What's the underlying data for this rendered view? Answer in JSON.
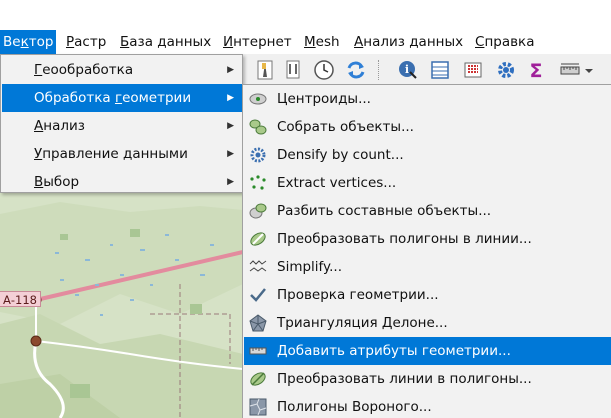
{
  "menubar": {
    "items": [
      {
        "pre": "Ве",
        "acc": "к",
        "post": "тор"
      },
      {
        "pre": "",
        "acc": "Р",
        "post": "астр"
      },
      {
        "pre": "",
        "acc": "Б",
        "post": "аза данных"
      },
      {
        "pre": "",
        "acc": "И",
        "post": "нтернет"
      },
      {
        "pre": "",
        "acc": "M",
        "post": "esh"
      },
      {
        "pre": "",
        "acc": "А",
        "post": "нализ данных"
      },
      {
        "pre": "",
        "acc": "С",
        "post": "правка"
      }
    ]
  },
  "vector_menu": {
    "items": [
      {
        "acc": "Г",
        "post": "еообработка"
      },
      {
        "pre": "Обработка ",
        "acc": "г",
        "post": "еометрии"
      },
      {
        "acc": "А",
        "post": "нализ"
      },
      {
        "acc": "У",
        "post": "правление данными"
      },
      {
        "acc": "В",
        "post": "ыбор"
      }
    ],
    "selected_index": 1
  },
  "geometry_submenu": {
    "items": [
      {
        "label": "Центроиды...",
        "icon": "centroids-icon"
      },
      {
        "label": "Собрать объекты...",
        "icon": "collect-geometries-icon"
      },
      {
        "label": "Densify by count...",
        "icon": "densify-icon"
      },
      {
        "label": "Extract vertices...",
        "icon": "extract-vertices-icon"
      },
      {
        "label": "Разбить составные объекты...",
        "icon": "multipart-to-singleparts-icon"
      },
      {
        "label": "Преобразовать полигоны в линии...",
        "icon": "polygons-to-lines-icon"
      },
      {
        "label": "Simplify...",
        "icon": "simplify-icon"
      },
      {
        "label": "Проверка геометрии...",
        "icon": "check-validity-icon"
      },
      {
        "label": "Триангуляция Делоне...",
        "icon": "delaunay-icon"
      },
      {
        "label": "Добавить атрибуты геометрии...",
        "icon": "add-geometry-attributes-icon"
      },
      {
        "label": "Преобразовать линии в полигоны...",
        "icon": "lines-to-polygons-icon"
      },
      {
        "label": "Полигоны Вороного...",
        "icon": "voronoi-icon"
      }
    ],
    "selected_index": 9
  },
  "map": {
    "road_label": "А-118"
  },
  "colors": {
    "accent": "#0078d7",
    "menu_bg": "#f2f2f2",
    "map_bg": "#d6e2c6"
  }
}
